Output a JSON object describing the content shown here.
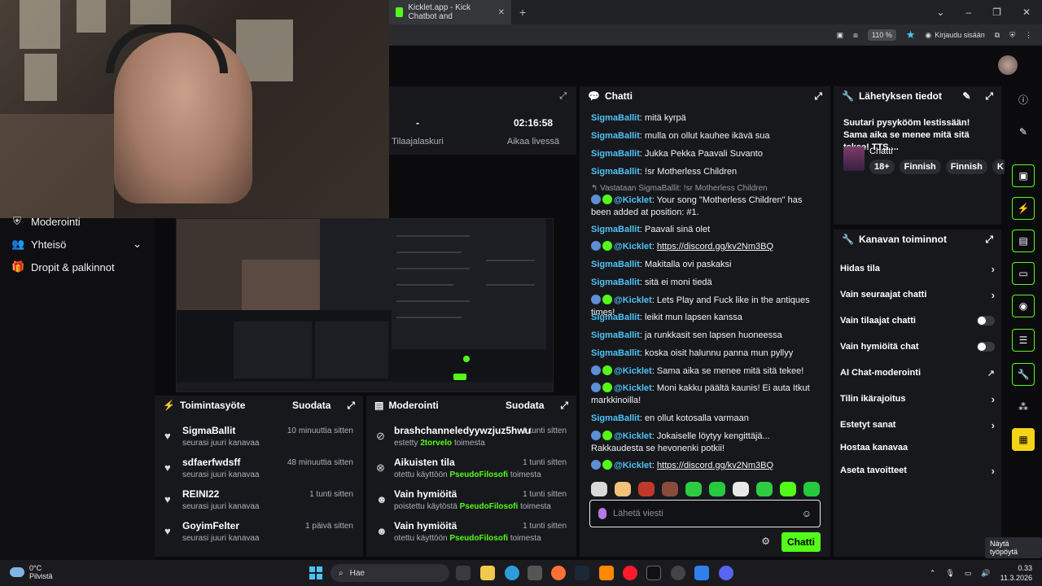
{
  "browser": {
    "tab_title": "Kicklet.app - Kick Chatbot and",
    "tab_close": "✕",
    "new_tab": "+",
    "zoom": "110 %",
    "sign_in": "Kirjaudu sisään"
  },
  "left_nav": {
    "items": [
      {
        "label": "Moderointi",
        "icon": "shield-icon"
      },
      {
        "label": "Yhteisö",
        "icon": "people-icon"
      },
      {
        "label": "Dropit & palkinnot",
        "icon": "gift-icon"
      }
    ]
  },
  "stats": {
    "left_value": "-",
    "left_label": "Tilaajalaskuri",
    "right_value": "02:16:58",
    "right_label": "Aikaa livessä"
  },
  "activity": {
    "title": "Toimintasyöte",
    "filter": "Suodata",
    "rows": [
      {
        "name": "SigmaBallit",
        "time": "10 minuuttia sitten",
        "sub": "seurasi juuri kanavaa"
      },
      {
        "name": "sdfaerfwdsff",
        "time": "48 minuuttia sitten",
        "sub": "seurasi juuri kanavaa"
      },
      {
        "name": "REINI22",
        "time": "1 tunti sitten",
        "sub": "seurasi juuri kanavaa"
      },
      {
        "name": "GoyimFelter",
        "time": "1 päivä sitten",
        "sub": "seurasi juuri kanavaa"
      }
    ]
  },
  "moderation": {
    "title": "Moderointi",
    "filter": "Suodata",
    "rows": [
      {
        "name": "brashchanneledyywzjuz5hwu",
        "time": "1 tunti sitten",
        "pre": "estetty",
        "who": "2torvelo",
        "post": "toimesta"
      },
      {
        "name": "Aikuisten tila",
        "time": "1 tunti sitten",
        "pre": "otettu käyttöön",
        "who": "PseudoFilosofi",
        "post": "toimesta"
      },
      {
        "name": "Vain hymiöitä",
        "time": "1 tunti sitten",
        "pre": "poistettu käytöstä",
        "who": "PseudoFilosofi",
        "post": "toimesta"
      },
      {
        "name": "Vain hymiöitä",
        "time": "1 tunti sitten",
        "pre": "otettu käyttöön",
        "who": "PseudoFilosofi",
        "post": "toimesta"
      }
    ]
  },
  "chat": {
    "title": "Chatti",
    "messages": [
      {
        "user": "SigmaBallit",
        "text": ": mitä kyrpä"
      },
      {
        "user": "SigmaBallit",
        "text": ": mulla on ollut kauhee ikävä sua"
      },
      {
        "user": "SigmaBallit",
        "text": ": Jukka Pekka Paavali Suvanto"
      },
      {
        "user": "SigmaBallit",
        "text": ": !sr Motherless Children"
      },
      {
        "reply": "↰ Vastataan SigmaBallit: !sr Motherless Children",
        "bot": "@Kicklet",
        "text": ": Your song \"Motherless Children\" has been added at position: #1."
      },
      {
        "user": "SigmaBallit",
        "text": ": Paavali sinä olet"
      },
      {
        "bot": "@Kicklet",
        "text": ": ",
        "link": "https://discord.gg/kv2Nm3BQ"
      },
      {
        "user": "SigmaBallit",
        "text": ": Makitalla ovi paskaksi"
      },
      {
        "user": "SigmaBallit",
        "text": ": sitä ei moni tiedä"
      },
      {
        "bot": "@Kicklet",
        "text": ": Lets Play and Fuck like in the antiques times!"
      },
      {
        "user": "SigmaBallit",
        "text": ": leikit mun lapsen kanssa"
      },
      {
        "user": "SigmaBallit",
        "text": ": ja runkkasit sen lapsen huoneessa"
      },
      {
        "user": "SigmaBallit",
        "text": ": koska oisit halunnu panna mun pyllyy"
      },
      {
        "bot": "@Kicklet",
        "text": ": Sama aika se menee mitä sitä tekee!"
      },
      {
        "bot": "@Kicklet",
        "text": ": Moni kakku päältä kaunis! Ei auta Itkut markkinoilla!"
      },
      {
        "user": "SigmaBallit",
        "text": ": en ollut kotosalla varmaan"
      },
      {
        "bot": "@Kicklet",
        "text": ": Jokaiselle löytyy kengittäjä... Rakkaudesta se hevonenki potkii!"
      },
      {
        "bot": "@Kicklet",
        "text": ": ",
        "link": "https://discord.gg/kv2Nm3BQ"
      }
    ],
    "placeholder": "Lähetä viesti",
    "send": "Chatti"
  },
  "broadcast": {
    "title": "Lähetyksen tiedot",
    "stream_title": "Suutari pysykööm lestissään! Sama aika se menee mitä sitä tekee! TTS ...",
    "category": "Chatti",
    "tags": [
      "18+",
      "Finnish",
      "Finnish",
      "K"
    ]
  },
  "channel_actions": {
    "title": "Kanavan toiminnot",
    "items": [
      {
        "label": "Hidas tila",
        "ctrl": "›"
      },
      {
        "label": "Vain seuraajat chatti",
        "ctrl": "›"
      },
      {
        "label": "Vain tilaajat chatti",
        "ctrl": "toggle"
      },
      {
        "label": "Vain hymiöitä chat",
        "ctrl": "toggle"
      },
      {
        "label": "AI Chat-moderointi",
        "ctrl": "↗"
      },
      {
        "label": "Tilin ikärajoitus",
        "ctrl": "›"
      },
      {
        "label": "Estetyt sanat",
        "ctrl": "›"
      },
      {
        "label": "Hostaa kanavaa",
        "ctrl": ""
      },
      {
        "label": "Aseta tavoitteet",
        "ctrl": "›"
      }
    ]
  },
  "tooltip": "Näytä työpöytä",
  "taskbar": {
    "temp": "0°C",
    "weather": "Pilvistä",
    "search": "Hae",
    "time": "0.33",
    "date": "11.3.2026"
  },
  "colors": {
    "accent": "#53fc18",
    "link": "#4fc3f7",
    "panel": "#17181c"
  }
}
